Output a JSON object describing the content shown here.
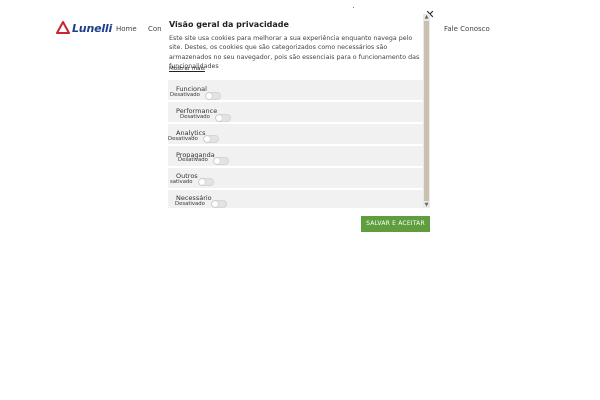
{
  "header": {
    "logo_text": "Lunelli",
    "nav": [
      {
        "label": "Home"
      },
      {
        "label": "Con"
      },
      {
        "label": "Fale Conosco"
      }
    ]
  },
  "modal": {
    "title": "Visão geral da privacidade",
    "description": "Este site usa cookies para melhorar a sua experiência enquanto navega pelo site. Destes, os cookies que são categorizados como necessários são armazenados no seu navegador, pois são essenciais para o funcionamento das funcionalidades",
    "more_link": "Mostrar mais",
    "close_symbol": "✕",
    "categories": [
      {
        "name": "Funcional",
        "status": "Desativado"
      },
      {
        "name": "Performance",
        "status": "Desativado"
      },
      {
        "name": "Analytics",
        "status": "Desativado"
      },
      {
        "name": "Propaganda",
        "status": "Desativado"
      },
      {
        "name": "Outros",
        "status": "sativado"
      },
      {
        "name": "Necessário",
        "status": "Desativado"
      }
    ],
    "save_button": "SALVAR E ACEITAR"
  },
  "colors": {
    "brand_blue": "#1f3e8a",
    "logo_red": "#c8252c",
    "button_green": "#5f9e3f",
    "row_bg": "#f1f1f1"
  },
  "icons": {
    "close": "close-icon",
    "logo": "lunelli-logo-icon"
  }
}
